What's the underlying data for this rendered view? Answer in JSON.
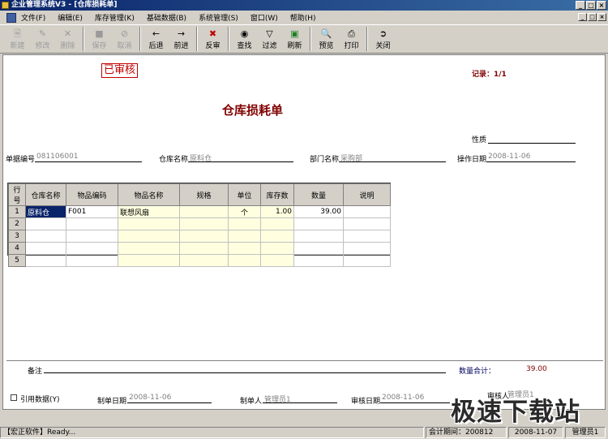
{
  "window": {
    "title": "企业管理系统V3 - [仓库损耗单]",
    "min_glyph": "_",
    "max_glyph": "□",
    "close_glyph": "×"
  },
  "menu": [
    "文件(F)",
    "编辑(E)",
    "库存管理(K)",
    "基础数据(B)",
    "系统管理(S)",
    "窗口(W)",
    "帮助(H)"
  ],
  "toolbar": {
    "new": "新建",
    "edit": "修改",
    "delete": "删除",
    "save": "保存",
    "cancel": "取消",
    "back": "后退",
    "forward": "前进",
    "unaudit": "反审",
    "find": "查找",
    "filter": "过滤",
    "refresh": "刷新",
    "preview": "预览",
    "print": "打印",
    "close": "关闭"
  },
  "doc": {
    "stamp": "已审核",
    "record_label": "记录：1/1",
    "title": "仓库损耗单",
    "nature_label": "性质",
    "nature_value": "",
    "bill_no_label": "单据编号",
    "bill_no_value": "081106001",
    "warehouse_label": "仓库名称",
    "warehouse_value": "原料仓",
    "dept_label": "部门名称",
    "dept_value": "采购部",
    "op_date_label": "操作日期",
    "op_date_value": "2008-11-06"
  },
  "grid": {
    "headers": [
      "行号",
      "仓库名称",
      "物品编码",
      "物品名称",
      "规格",
      "单位",
      "库存数",
      "数量",
      "说明"
    ],
    "rows": [
      [
        "1",
        "原料仓",
        "F001",
        "联想风扇",
        "",
        "个",
        "1.00",
        "39.00",
        ""
      ],
      [
        "2",
        "",
        "",
        "",
        "",
        "",
        "",
        "",
        ""
      ],
      [
        "3",
        "",
        "",
        "",
        "",
        "",
        "",
        "",
        ""
      ],
      [
        "4",
        "",
        "",
        "",
        "",
        "",
        "",
        "",
        ""
      ],
      [
        "5",
        "",
        "",
        "",
        "",
        "",
        "",
        "",
        ""
      ]
    ]
  },
  "footer": {
    "remark_label": "备注",
    "qty_total_label": "数量合计：",
    "qty_total_value": "39.00",
    "cite_label": "引用数据(Y)",
    "made_date_label": "制单日期",
    "made_date_value": "2008-11-06",
    "maker_label": "制单人",
    "maker_value": "管理员1",
    "audit_date_label": "审核日期",
    "audit_date_value": "2008-11-06",
    "auditor_label": "审核人",
    "auditor_value": "管理员1"
  },
  "status": {
    "app": "【宏正软件】Ready...",
    "period": "会计期间：200812",
    "date": "2008-11-07",
    "user": "管理员1"
  },
  "watermark": "极速下载站",
  "colors": {
    "title_red": "#800000",
    "stamp_red": "#c00000",
    "grid_yellow": "#ffffe0",
    "selected": "#0a246a"
  }
}
